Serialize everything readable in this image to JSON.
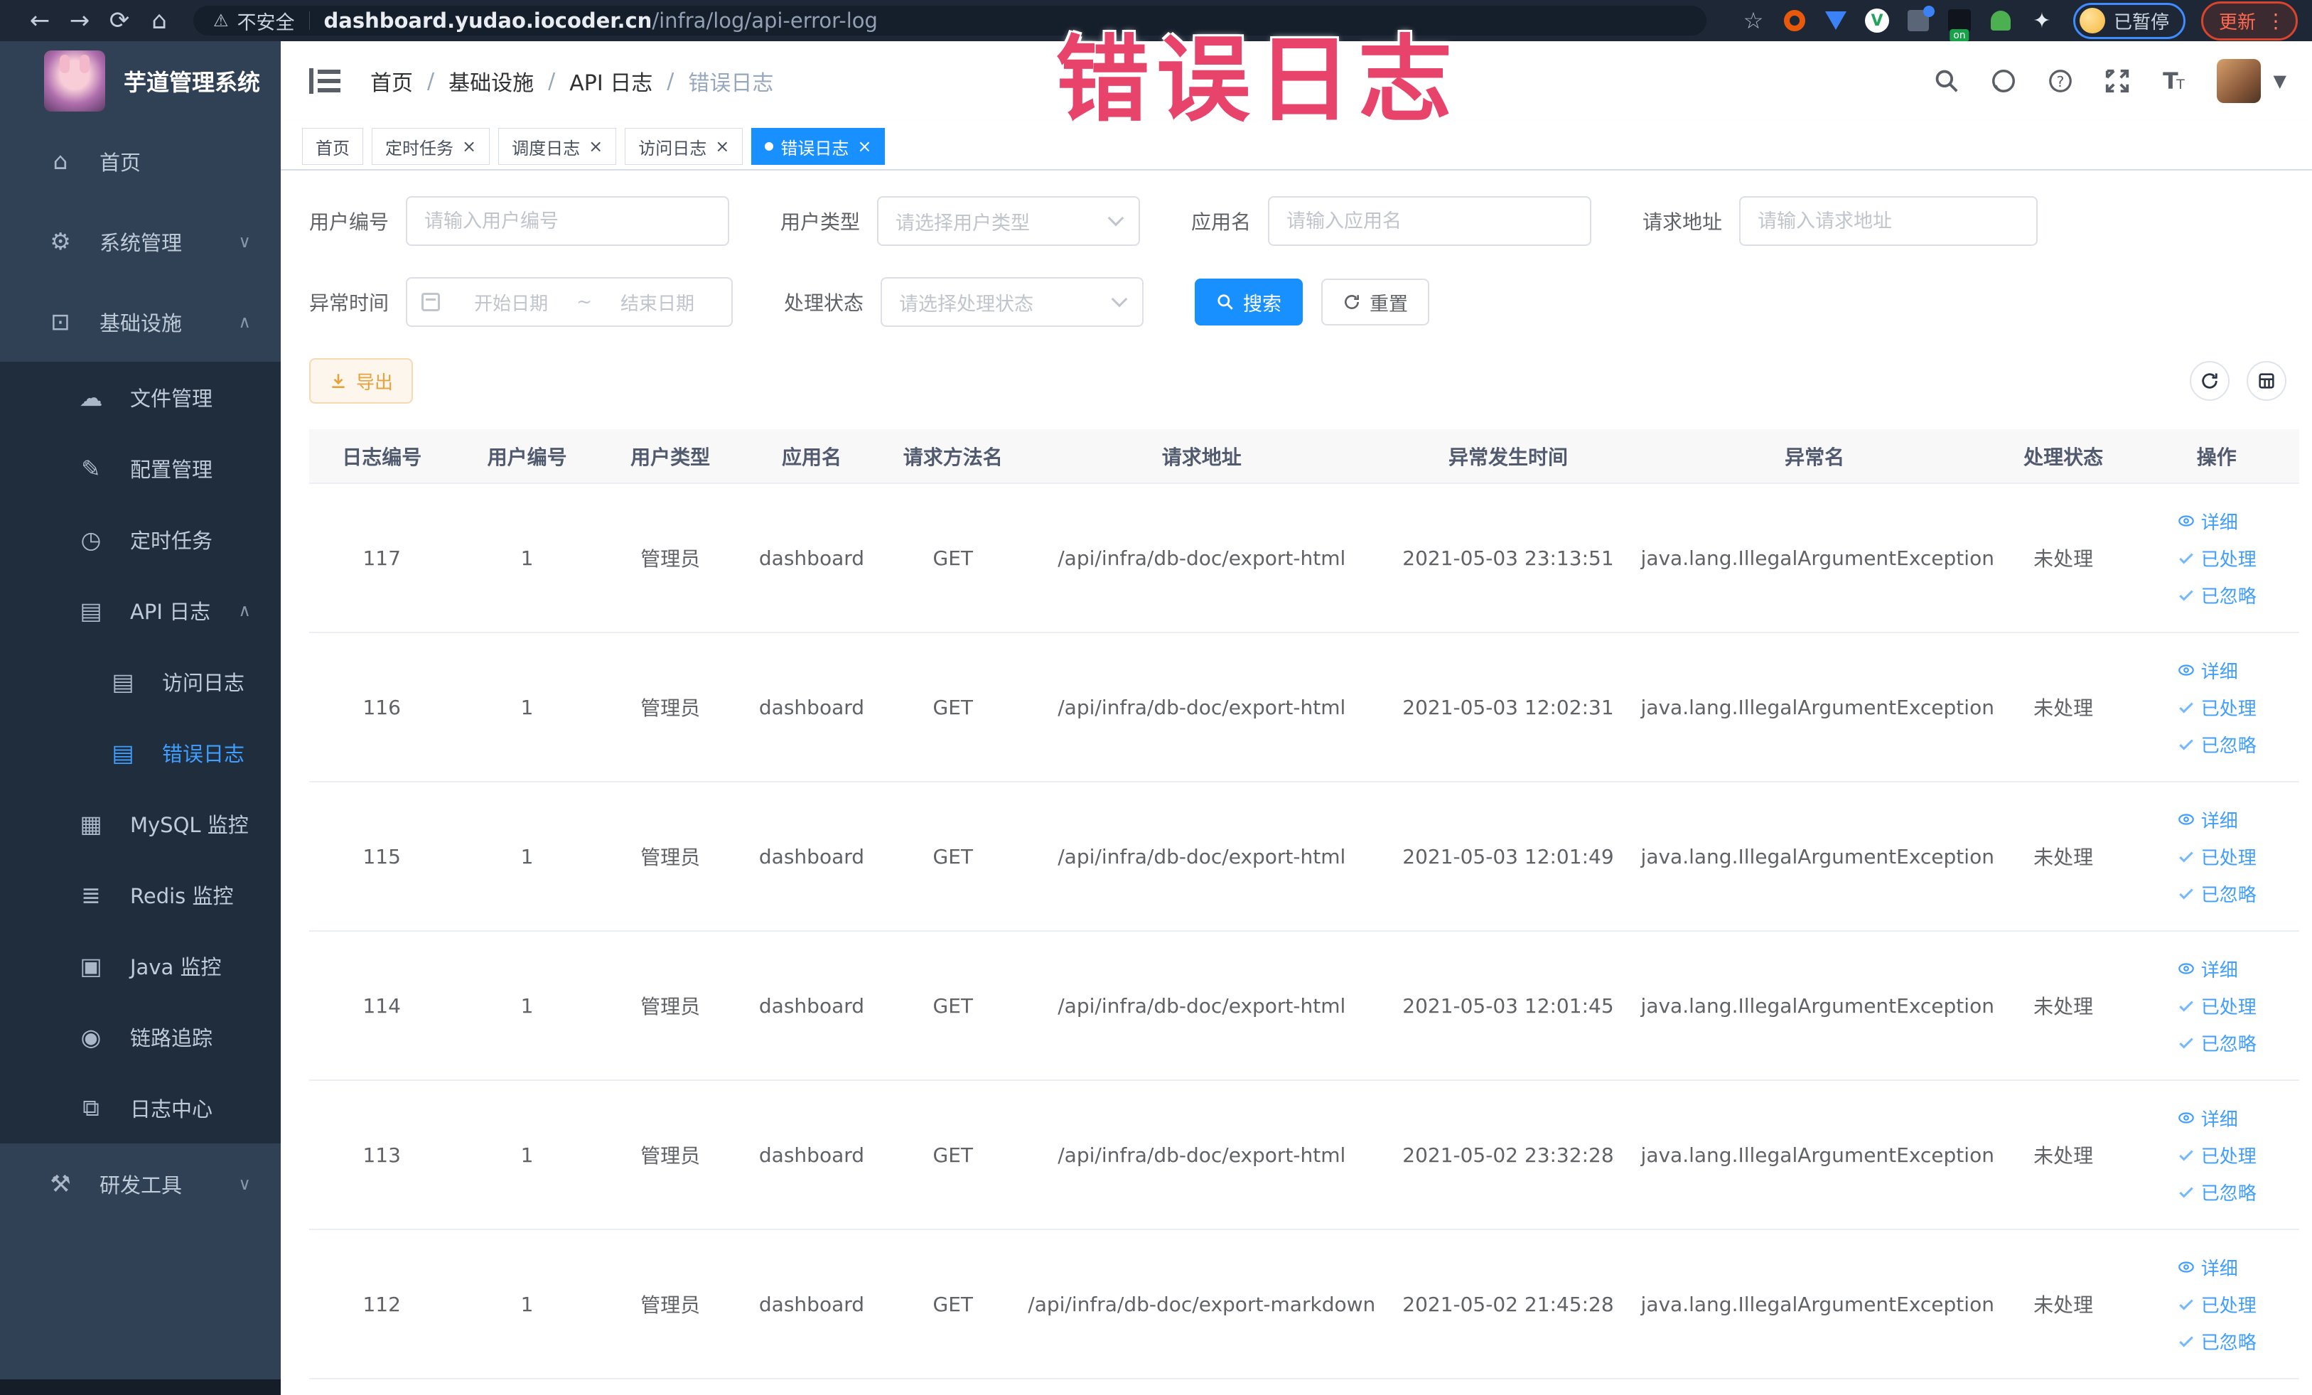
{
  "browser": {
    "security_label": "不安全",
    "url_domain": "dashboard.yudao.iocoder.cn",
    "url_path": "/infra/log/api-error-log",
    "extension_badge": "on",
    "paused_badge": "已暂停",
    "update_button": "更新"
  },
  "overlay": {
    "text": "错误日志"
  },
  "sidebar": {
    "logo_title": "芋道管理系统",
    "items": [
      {
        "label": "首页",
        "icon": "⌂",
        "cls": "level-1",
        "chevron": ""
      },
      {
        "label": "系统管理",
        "icon": "⚙",
        "cls": "level-1",
        "chevron": "∨"
      },
      {
        "label": "基础设施",
        "icon": "⊡",
        "cls": "level-1",
        "chevron": "∧"
      },
      {
        "label": "文件管理",
        "icon": "☁",
        "cls": "level-2",
        "chevron": ""
      },
      {
        "label": "配置管理",
        "icon": "✎",
        "cls": "level-2",
        "chevron": ""
      },
      {
        "label": "定时任务",
        "icon": "◷",
        "cls": "level-2",
        "chevron": ""
      },
      {
        "label": "API 日志",
        "icon": "▤",
        "cls": "level-2",
        "chevron": "∧"
      },
      {
        "label": "访问日志",
        "icon": "▤",
        "cls": "level-3",
        "chevron": ""
      },
      {
        "label": "错误日志",
        "icon": "▤",
        "cls": "level-3 active",
        "chevron": ""
      },
      {
        "label": "MySQL 监控",
        "icon": "▦",
        "cls": "level-2",
        "chevron": ""
      },
      {
        "label": "Redis 监控",
        "icon": "≣",
        "cls": "level-2",
        "chevron": ""
      },
      {
        "label": "Java 监控",
        "icon": "▣",
        "cls": "level-2",
        "chevron": ""
      },
      {
        "label": "链路追踪",
        "icon": "◉",
        "cls": "level-2",
        "chevron": ""
      },
      {
        "label": "日志中心",
        "icon": "⧉",
        "cls": "level-2",
        "chevron": ""
      },
      {
        "label": "研发工具",
        "icon": "⚒",
        "cls": "level-1",
        "chevron": "∨"
      }
    ]
  },
  "header": {
    "breadcrumb_sep": "/",
    "breadcrumb": [
      {
        "label": "首页",
        "cls": ""
      },
      {
        "label": "基础设施",
        "cls": ""
      },
      {
        "label": "API 日志",
        "cls": ""
      },
      {
        "label": "错误日志",
        "cls": "last"
      }
    ]
  },
  "tabbar": {
    "close": "×",
    "tabs": [
      {
        "label": "首页",
        "cls": ""
      },
      {
        "label": "定时任务",
        "cls": "closable"
      },
      {
        "label": "调度日志",
        "cls": "closable"
      },
      {
        "label": "访问日志",
        "cls": "closable"
      },
      {
        "label": "错误日志",
        "cls": "closable active"
      }
    ]
  },
  "filters": {
    "user_id": {
      "label": "用户编号",
      "placeholder": "请输入用户编号"
    },
    "user_type": {
      "label": "用户类型",
      "placeholder": "请选择用户类型"
    },
    "app_name": {
      "label": "应用名",
      "placeholder": "请输入应用名"
    },
    "request_url": {
      "label": "请求地址",
      "placeholder": "请输入请求地址"
    },
    "exception_time": {
      "label": "异常时间",
      "start_placeholder": "开始日期",
      "separator": "~",
      "end_placeholder": "结束日期"
    },
    "process_status": {
      "label": "处理状态",
      "placeholder": "请选择处理状态"
    },
    "search_button": "搜索",
    "reset_button": "重置"
  },
  "toolbar": {
    "export_button": "导出"
  },
  "table": {
    "columns": [
      "日志编号",
      "用户编号",
      "用户类型",
      "应用名",
      "请求方法名",
      "请求地址",
      "异常发生时间",
      "异常名",
      "处理状态",
      "操作"
    ],
    "actions": {
      "detail": "详细",
      "processed": "已处理",
      "ignored": "已忽略"
    },
    "rows": [
      {
        "log_id": "117",
        "user_id": "1",
        "user_type": "管理员",
        "app_name": "dashboard",
        "method": "GET",
        "url": "/api/infra/db-doc/export-html",
        "time": "2021-05-03 23:13:51",
        "exception": "java.lang.IllegalArgumentException",
        "status": "未处理"
      },
      {
        "log_id": "116",
        "user_id": "1",
        "user_type": "管理员",
        "app_name": "dashboard",
        "method": "GET",
        "url": "/api/infra/db-doc/export-html",
        "time": "2021-05-03 12:02:31",
        "exception": "java.lang.IllegalArgumentException",
        "status": "未处理"
      },
      {
        "log_id": "115",
        "user_id": "1",
        "user_type": "管理员",
        "app_name": "dashboard",
        "method": "GET",
        "url": "/api/infra/db-doc/export-html",
        "time": "2021-05-03 12:01:49",
        "exception": "java.lang.IllegalArgumentException",
        "status": "未处理"
      },
      {
        "log_id": "114",
        "user_id": "1",
        "user_type": "管理员",
        "app_name": "dashboard",
        "method": "GET",
        "url": "/api/infra/db-doc/export-html",
        "time": "2021-05-03 12:01:45",
        "exception": "java.lang.IllegalArgumentException",
        "status": "未处理"
      },
      {
        "log_id": "113",
        "user_id": "1",
        "user_type": "管理员",
        "app_name": "dashboard",
        "method": "GET",
        "url": "/api/infra/db-doc/export-html",
        "time": "2021-05-02 23:32:28",
        "exception": "java.lang.IllegalArgumentException",
        "status": "未处理"
      },
      {
        "log_id": "112",
        "user_id": "1",
        "user_type": "管理员",
        "app_name": "dashboard",
        "method": "GET",
        "url": "/api/infra/db-doc/export-markdown",
        "time": "2021-05-02 21:45:28",
        "exception": "java.lang.IllegalArgumentException",
        "status": "未处理"
      }
    ]
  },
  "colors": {
    "accent": "#1890ff",
    "active_link": "#409eff",
    "sidebar_bg": "#304156",
    "submenu_bg": "#1f2d3d",
    "export_text": "#e6a23c",
    "overlay_text": "#e8436b",
    "browser_bar_bg": "#1e2736"
  }
}
